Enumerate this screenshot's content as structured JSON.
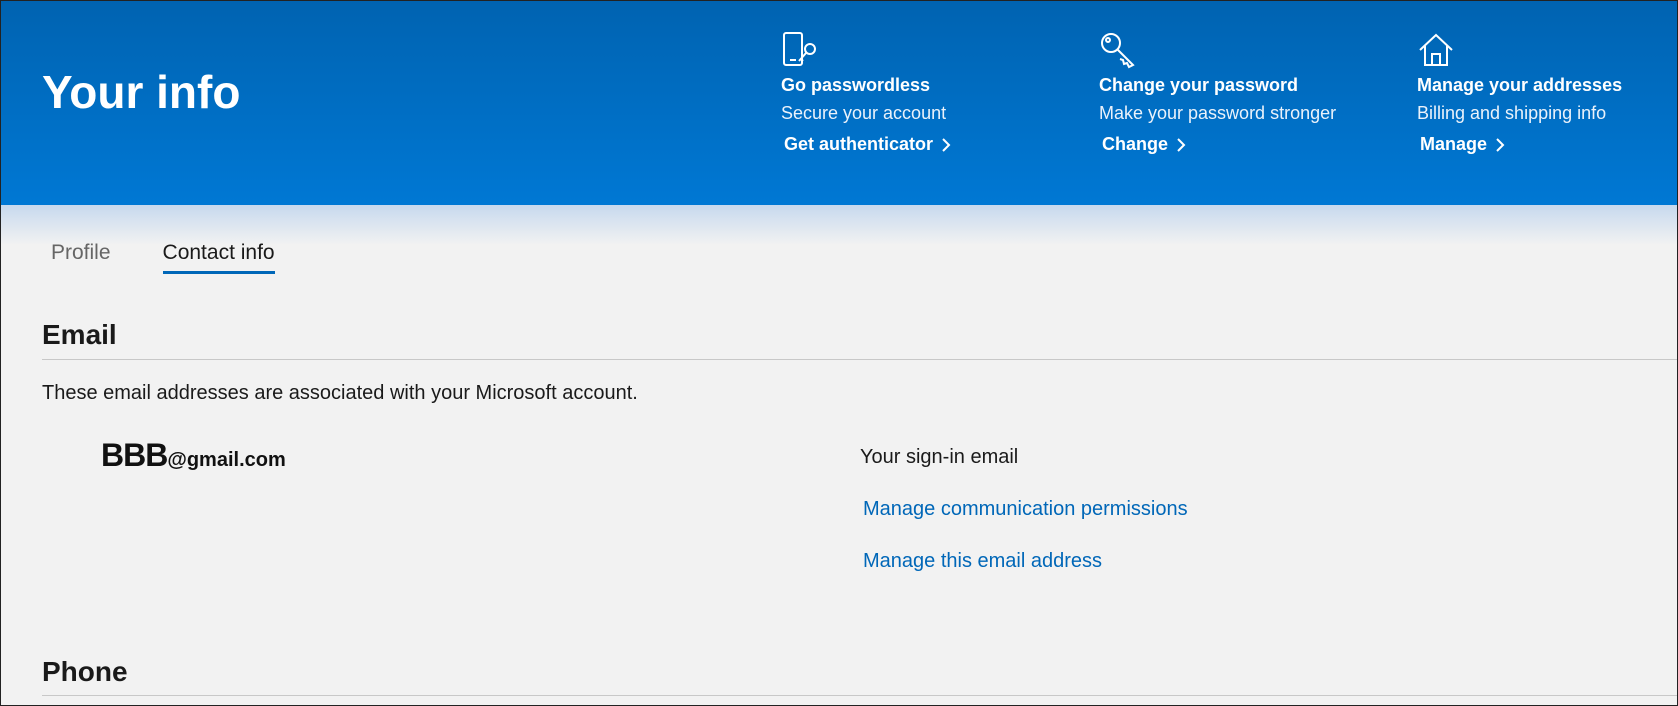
{
  "header": {
    "title": "Your info",
    "quick_actions": [
      {
        "icon": "phone-key-icon",
        "title": "Go passwordless",
        "subtitle": "Secure your account",
        "link": "Get authenticator"
      },
      {
        "icon": "key-icon",
        "title": "Change your password",
        "subtitle": "Make your password stronger",
        "link": "Change"
      },
      {
        "icon": "house-icon",
        "title": "Manage your addresses",
        "subtitle": "Billing and shipping info",
        "link": "Manage"
      }
    ]
  },
  "tabs": [
    {
      "label": "Profile",
      "active": false
    },
    {
      "label": "Contact info",
      "active": true
    }
  ],
  "email_section": {
    "title": "Email",
    "description": "These email addresses are associated with your Microsoft account.",
    "address_redacted": "BBB",
    "address_domain": "@gmail.com",
    "signin_label": "Your sign-in email",
    "links": {
      "communication": "Manage communication permissions",
      "manage": "Manage this email address"
    }
  },
  "phone_section": {
    "title": "Phone"
  },
  "colors": {
    "header_top": "#0063b1",
    "header_bottom": "#0078d4",
    "link": "#0067b8",
    "background": "#f2f2f2"
  }
}
